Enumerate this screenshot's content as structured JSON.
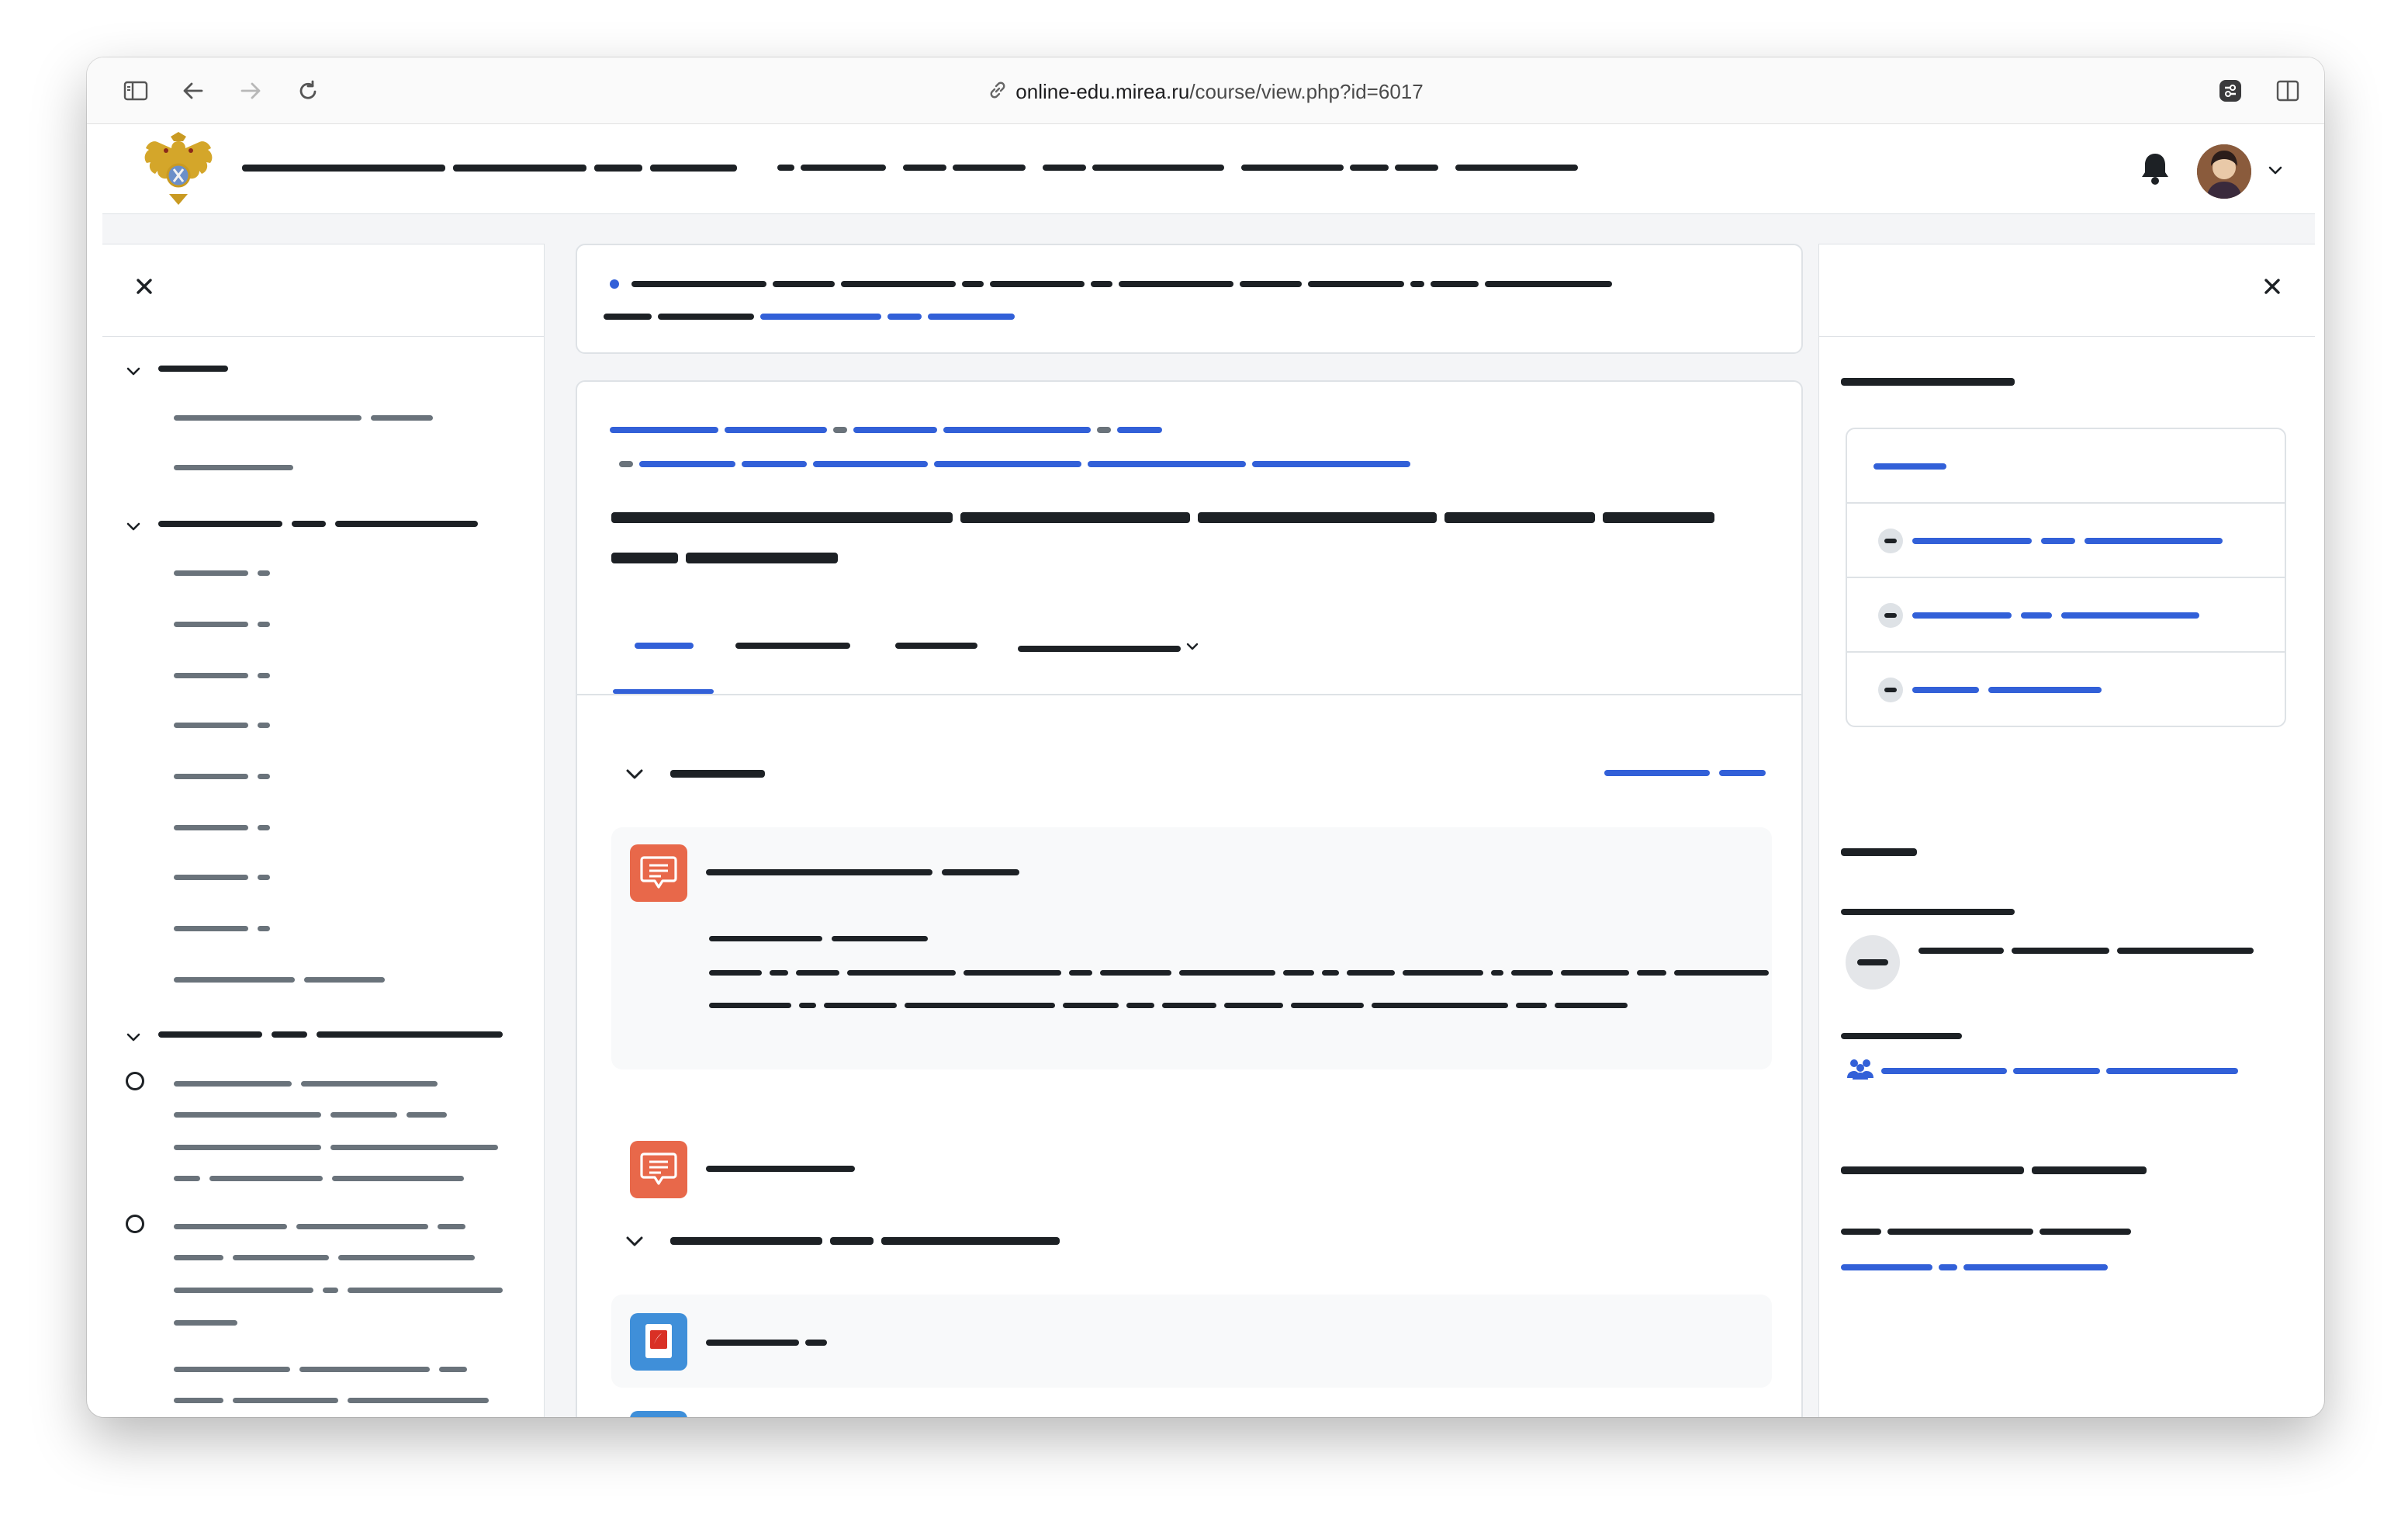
{
  "browser": {
    "url_host": "online-edu.mirea.ru",
    "url_path": "/course/view.php?id=6017",
    "icons": [
      "sidebar-icon",
      "back-icon",
      "forward-icon",
      "reload-icon",
      "link-icon",
      "extension-icon",
      "split-view-icon"
    ]
  },
  "header": {
    "logo": "coat-of-arms-logo",
    "icons": [
      "bell-icon",
      "avatar",
      "chevron-down-icon"
    ]
  },
  "colors": {
    "accent": "#3260d8",
    "text": "#1d2125",
    "muted": "#6a737b",
    "activity_forum": "#e8684a",
    "activity_file": "#3f8fd9",
    "page_bg": "#f4f5f7"
  },
  "main": {
    "tabs": [
      "tab-course",
      "tab-participants",
      "tab-grades",
      "tab-more"
    ],
    "active_tab": 0
  }
}
